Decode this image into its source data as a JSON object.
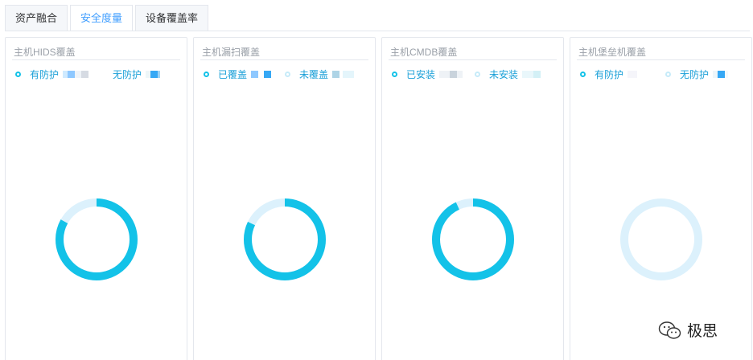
{
  "tabs": [
    {
      "label": "资产融合",
      "active": false
    },
    {
      "label": "安全度量",
      "active": true
    },
    {
      "label": "设备覆盖率",
      "active": false
    }
  ],
  "colors": {
    "accent": "#13c2e8",
    "track": "#dcf1fc",
    "tab_active": "#409eff",
    "legend_text": "#1ba0d8"
  },
  "cards": [
    {
      "title": "主机HIDS覆盖",
      "legend": [
        {
          "label": "有防护",
          "dot": "solid",
          "value_icon": "redacted-blur-icon"
        },
        {
          "label": "无防护",
          "dot": "solid",
          "value_icon": "redacted-blur-icon"
        }
      ],
      "covered_fraction": 0.83
    },
    {
      "title": "主机漏扫覆盖",
      "legend": [
        {
          "label": "已覆盖",
          "dot": "solid",
          "value_icon": "redacted-blur-icon"
        },
        {
          "label": "未覆盖",
          "dot": "light",
          "value_icon": "redacted-blur-icon"
        }
      ],
      "covered_fraction": 0.82
    },
    {
      "title": "主机CMDB覆盖",
      "legend": [
        {
          "label": "已安装",
          "dot": "solid",
          "value_icon": "redacted-blur-icon"
        },
        {
          "label": "未安装",
          "dot": "light",
          "value_icon": "redacted-blur-icon"
        }
      ],
      "covered_fraction": 0.93
    },
    {
      "title": "主机堡垒机覆盖",
      "legend": [
        {
          "label": "有防护",
          "dot": "solid",
          "value_icon": "redacted-blur-icon"
        },
        {
          "label": "无防护",
          "dot": "light",
          "value_icon": "redacted-blur-icon"
        }
      ],
      "covered_fraction": 0.0
    }
  ],
  "watermark": {
    "icon": "wechat-icon",
    "text": "极思"
  }
}
